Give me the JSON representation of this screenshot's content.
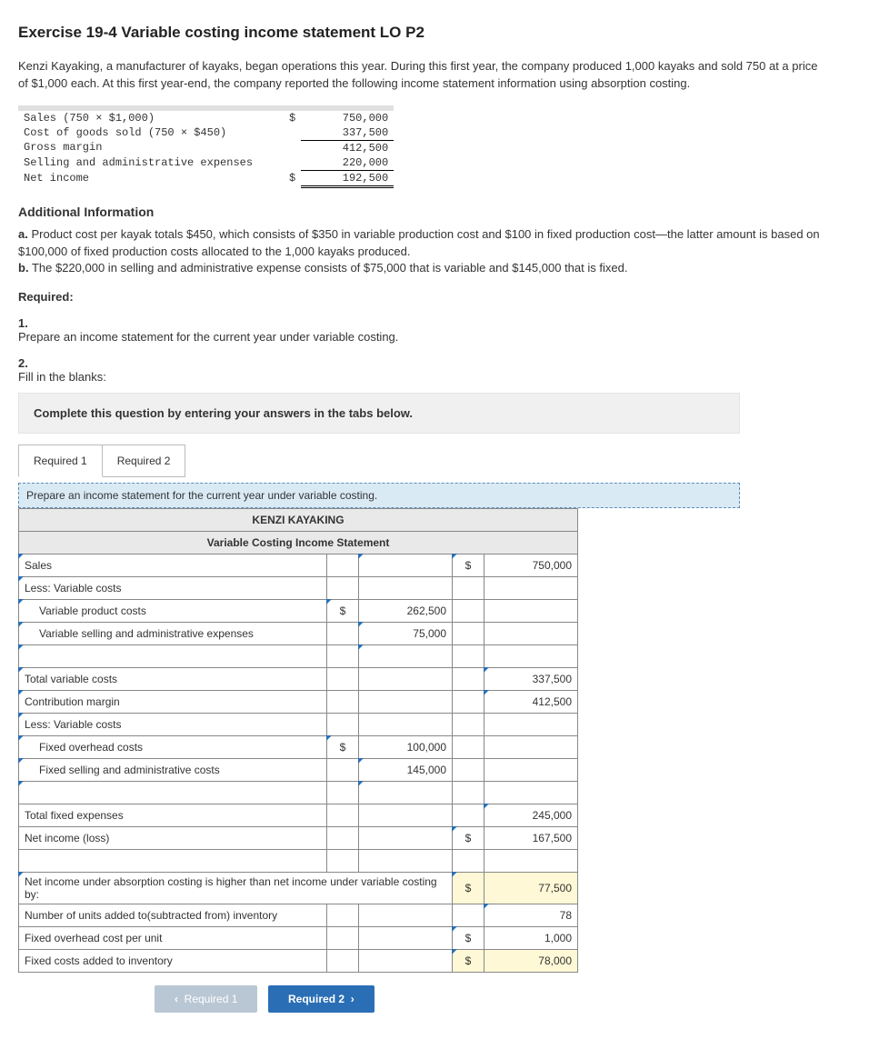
{
  "title": "Exercise 19-4 Variable costing income statement LO P2",
  "intro": "Kenzi Kayaking, a manufacturer of kayaks, began operations this year. During this first year, the company produced 1,000 kayaks and sold 750 at a price of $1,000 each. At this first year-end, the company reported the following income statement information using absorption costing.",
  "absorption": {
    "rows": [
      {
        "label": "Sales (750 × $1,000)",
        "sym": "$",
        "amount": "750,000"
      },
      {
        "label": "Cost of goods sold (750 × $450)",
        "sym": "",
        "amount": "337,500"
      },
      {
        "label": "Gross margin",
        "sym": "",
        "amount": "412,500"
      },
      {
        "label": "Selling and administrative expenses",
        "sym": "",
        "amount": "220,000"
      },
      {
        "label": "Net income",
        "sym": "$",
        "amount": "192,500"
      }
    ]
  },
  "additional_heading": "Additional Information",
  "info_a_label": "a.",
  "info_a": "Product cost per kayak totals $450, which consists of $350 in variable production cost and $100 in fixed production cost—the latter amount is based on $100,000 of fixed production costs allocated to the 1,000 kayaks produced.",
  "info_b_label": "b.",
  "info_b": "The $220,000 in selling and administrative expense consists of $75,000 that is variable and $145,000 that is fixed.",
  "required_heading": "Required:",
  "req1_label": "1.",
  "req1": "Prepare an income statement for the current year under variable costing.",
  "req2_label": "2.",
  "req2": "Fill in the blanks:",
  "instruction": "Complete this question by entering your answers in the tabs below.",
  "tabs": {
    "t1": "Required 1",
    "t2": "Required 2"
  },
  "sub_instruction": "Prepare an income statement for the current year under variable costing.",
  "sheet": {
    "company": "KENZI KAYAKING",
    "stmt_title": "Variable Costing Income Statement",
    "rows": {
      "sales": {
        "label": "Sales",
        "sym2": "$",
        "val2": "750,000"
      },
      "less1": {
        "label": "Less: Variable costs"
      },
      "vpc": {
        "label": "Variable product costs",
        "sym1": "$",
        "val1": "262,500"
      },
      "vsae": {
        "label": "Variable selling and administrative expenses",
        "val1": "75,000"
      },
      "tvc": {
        "label": "Total variable costs",
        "val2": "337,500"
      },
      "cm": {
        "label": "Contribution margin",
        "val2": "412,500"
      },
      "less2": {
        "label": "Less: Variable costs"
      },
      "foc": {
        "label": "Fixed overhead costs",
        "sym1": "$",
        "val1": "100,000"
      },
      "fsac": {
        "label": "Fixed selling and administrative costs",
        "val1": "145,000"
      },
      "tfe": {
        "label": "Total fixed expenses",
        "val2": "245,000"
      },
      "ni": {
        "label": "Net income (loss)",
        "sym2": "$",
        "val2": "167,500"
      },
      "diff": {
        "label": "Net income under absorption costing is higher than net income under variable costing by:",
        "sym2": "$",
        "val2": "77,500"
      },
      "units": {
        "label": "Number of units added to(subtracted from) inventory",
        "val2": "78"
      },
      "focpu": {
        "label": "Fixed overhead cost per unit",
        "sym2": "$",
        "val2": "1,000"
      },
      "fcai": {
        "label": "Fixed costs added to inventory",
        "sym2": "$",
        "val2": "78,000"
      }
    }
  },
  "nav": {
    "prev": "Required 1",
    "next": "Required 2"
  }
}
